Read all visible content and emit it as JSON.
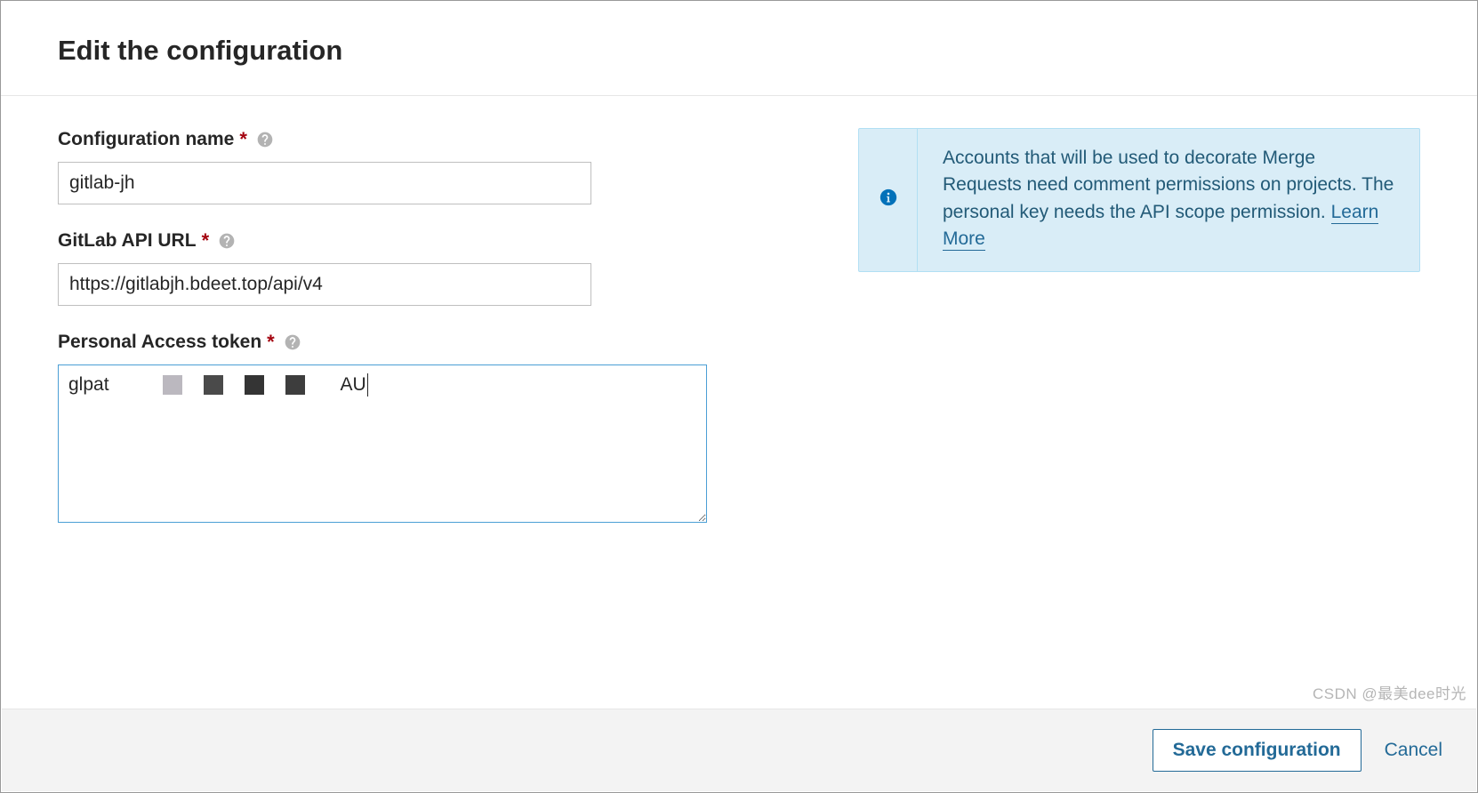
{
  "header": {
    "title": "Edit the configuration"
  },
  "form": {
    "config_name": {
      "label": "Configuration name",
      "value": "gitlab-jh"
    },
    "api_url": {
      "label": "GitLab API URL",
      "value": "https://gitlabjh.bdeet.top/api/v4"
    },
    "token": {
      "label": "Personal Access token",
      "prefix": "glpat",
      "suffix": "AU"
    }
  },
  "info": {
    "text": "Accounts that will be used to decorate Merge Requests need comment permissions on projects. The personal key needs the API scope permission. ",
    "link_label": "Learn More"
  },
  "footer": {
    "save_label": "Save configuration",
    "cancel_label": "Cancel"
  },
  "watermark": "CSDN @最美dee时光"
}
